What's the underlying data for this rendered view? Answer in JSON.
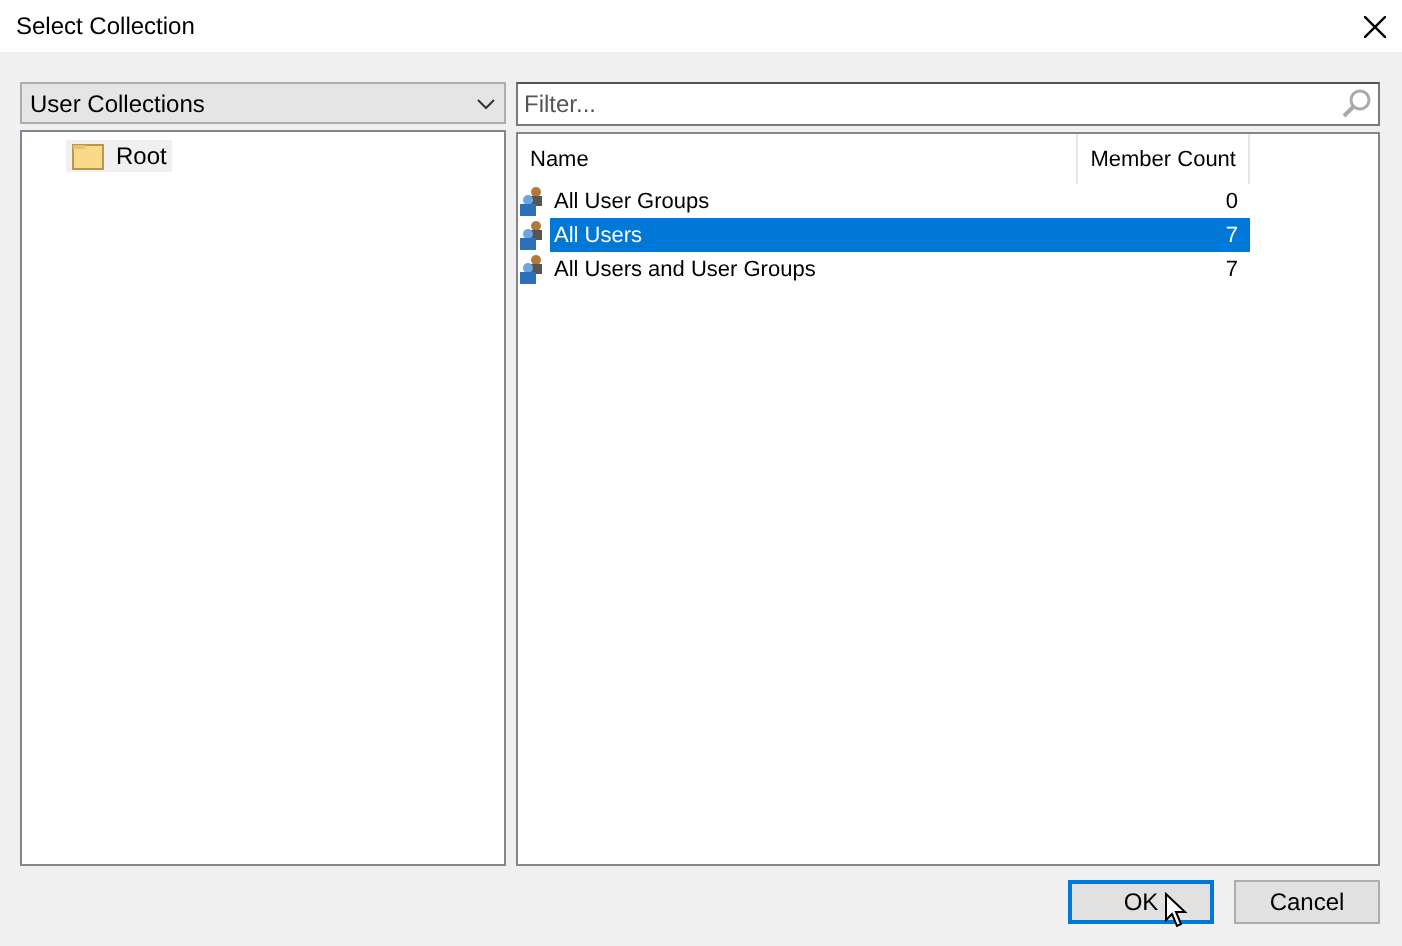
{
  "window": {
    "title": "Select Collection"
  },
  "collection_type": {
    "value": "User Collections"
  },
  "tree": {
    "items": [
      {
        "label": "Root",
        "selected": true
      }
    ]
  },
  "filter": {
    "placeholder": "Filter..."
  },
  "table": {
    "columns": [
      "Name",
      "Member Count"
    ],
    "rows": [
      {
        "name": "All User Groups",
        "member_count": "0",
        "selected": false
      },
      {
        "name": "All Users",
        "member_count": "7",
        "selected": true
      },
      {
        "name": "All Users and User Groups",
        "member_count": "7",
        "selected": false
      }
    ]
  },
  "buttons": [
    {
      "label": "OK",
      "kind": "default"
    },
    {
      "label": "Cancel",
      "kind": "normal"
    }
  ]
}
